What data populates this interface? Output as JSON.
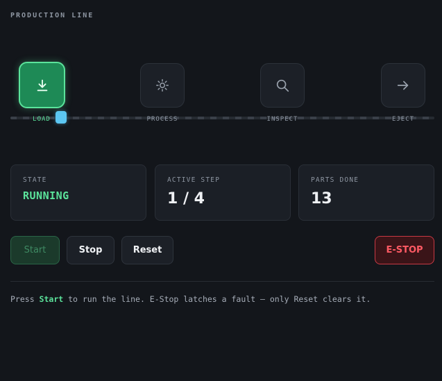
{
  "header": {
    "title": "PRODUCTION LINE"
  },
  "line": {
    "progress_fraction": 0.12,
    "stations": [
      {
        "label": "LOAD",
        "icon": "download-icon",
        "active": true
      },
      {
        "label": "PROCESS",
        "icon": "sun-gear-icon",
        "active": false
      },
      {
        "label": "INSPECT",
        "icon": "search-icon",
        "active": false
      },
      {
        "label": "EJECT",
        "icon": "arrow-right-icon",
        "active": false
      }
    ]
  },
  "stats": {
    "state_label": "STATE",
    "state_value": "RUNNING",
    "step_label": "ACTIVE STEP",
    "step_value": "1 / 4",
    "parts_label": "PARTS DONE",
    "parts_value": "13"
  },
  "controls": {
    "start_label": "Start",
    "stop_label": "Stop",
    "reset_label": "Reset",
    "estop_label": "E-STOP"
  },
  "help": {
    "prefix": "Press ",
    "emphasis": "Start",
    "suffix": " to run the line. E-Stop latches a fault — only Reset clears it."
  },
  "colors": {
    "accent_green": "#5be39b",
    "active_station_fill": "#1e8a56",
    "progress_handle": "#5cc6f2",
    "estop_red": "#ff5a64"
  }
}
